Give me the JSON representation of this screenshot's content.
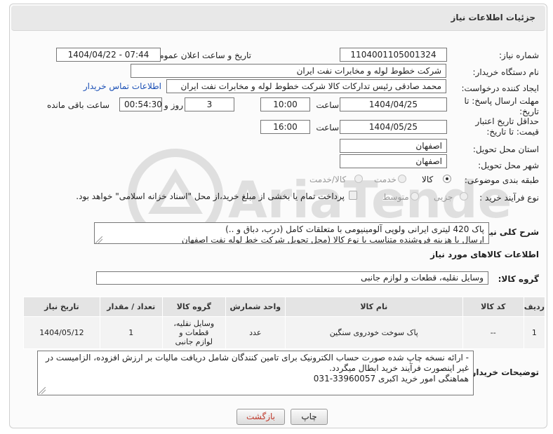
{
  "header": {
    "title": "جزئیات اطلاعات نیاز"
  },
  "labels": {
    "need_number": "شماره نیاز:",
    "announce_datetime": "تاریخ و ساعت اعلان عمومی:",
    "buyer_org": "نام دستگاه خریدار:",
    "requester": "ایجاد کننده درخواست:",
    "reply_deadline": "مهلت ارسال پاسخ: تا تاریخ:",
    "price_validity": "حداقل تاریخ اعتبار قیمت: تا تاریخ:",
    "province": "استان محل تحویل:",
    "city": "شهر محل تحویل:",
    "category": "طبقه بندی موضوعی:",
    "process_type": "نوع فرآیند خرید :",
    "time_word": "ساعت",
    "day_and": "روز و",
    "remaining": "ساعت باقی مانده",
    "description": "شرح کلی نیاز:",
    "goods_info": "اطلاعات کالاهای مورد نیاز",
    "goods_group": "گروه کالا:",
    "buyer_notes": "توضیحات خریدار:"
  },
  "values": {
    "need_number": "1104001105001324",
    "announce_datetime": "1404/04/22 - 07:44",
    "buyer_org": "شرکت خطوط لوله و مخابرات نفت ایران",
    "requester": "محمد صادقی رئیس تدارکات کالا  شرکت خطوط لوله و مخابرات نفت ایران",
    "contact_link": "اطلاعات تماس خریدار",
    "reply_date": "1404/04/25",
    "reply_time": "10:00",
    "days": "3",
    "remaining_time": "00:54:30",
    "validity_date": "1404/05/25",
    "validity_time": "16:00",
    "province": "اصفهان",
    "city": "اصفهان",
    "description": "پاک 420 لیتری ایرانی ولوپی آلومینیومی با متعلقات کامل (درب، دباق و ..)\nارسال  با هزینه فروشنده متناسب با نوع کالا (محل تحویل شرکت خط لوله نفت اصفهان",
    "goods_group": "وسایل نقلیه، قطعات و لوازم جانبی",
    "buyer_notes": "- ارائه نسخه چاپ شده صورت حساب الکترونیک برای تامین کنندگان شامل دریافت مالیات بر ارزش افزوده، الزامیست در غیر اینصورت فرآیند خرید ابطال میگردد.\nهماهنگی امور خرید اکبری 33960057-031"
  },
  "category_options": [
    {
      "label": "کالا",
      "selected": true,
      "disabled": false
    },
    {
      "label": "خدمت",
      "selected": false,
      "disabled": true
    },
    {
      "label": "کالا/خدمت",
      "selected": false,
      "disabled": true
    }
  ],
  "process_options": [
    {
      "label": "جزیی",
      "selected": false,
      "disabled": true
    },
    {
      "label": "متوسط",
      "selected": false,
      "disabled": true
    }
  ],
  "payment_note": "پرداخت تمام یا بخشی از مبلغ خرید،از محل \"اسناد خزانه اسلامی\" خواهد بود.",
  "table": {
    "headers": [
      "ردیف",
      "کد کالا",
      "نام کالا",
      "واحد شمارش",
      "گروه کالا",
      "تعداد / مقدار",
      "تاریخ نیاز"
    ],
    "rows": [
      [
        "1",
        "--",
        "پاک سوخت خودروی سنگین",
        "عدد",
        "وسایل نقلیه، قطعات و لوازم جانبی",
        "1",
        "1404/05/12"
      ]
    ]
  },
  "buttons": {
    "print": "چاپ",
    "back": "بازگشت"
  },
  "watermark": "AriaTender.net",
  "colors": {
    "back_button_text": "#c0392b",
    "link": "#1a4fb5",
    "header_bg": "#e8e8e8"
  }
}
